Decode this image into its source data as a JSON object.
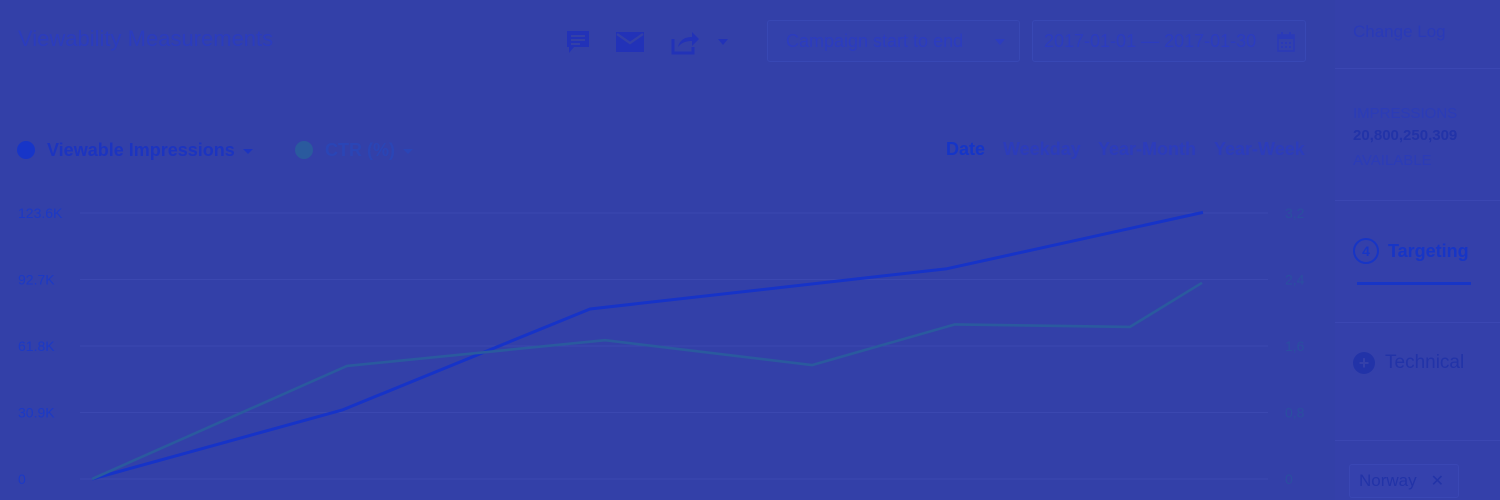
{
  "header": {
    "title": "Viewability Measurements",
    "icons": [
      "comment-icon",
      "mail-icon",
      "share-icon",
      "chevron-down-icon"
    ],
    "range_select": "Campaign start to end",
    "date_range": "2017-01-01 — 2017-01-30"
  },
  "legend": {
    "series1": "Viewable Impressions",
    "series2": "CTR (%)"
  },
  "granularity": {
    "options": [
      "Date",
      "Weekday",
      "Year-Month",
      "Year-Week"
    ],
    "active": "Date"
  },
  "colors": {
    "background": "#3340a8",
    "impressions": "#1633c8",
    "ctr": "#2a5a9e",
    "grid": "#3b48b0",
    "left_tick": "#1c39c6",
    "right_tick": "#2a4fa0"
  },
  "chart_data": {
    "type": "line",
    "x": [
      1,
      2,
      3,
      4,
      5,
      6,
      7,
      8
    ],
    "series": [
      {
        "name": "Viewable Impressions",
        "axis": "left",
        "values": [
          0,
          32000,
          79000,
          88500,
          97700,
          123900
        ]
      },
      {
        "name": "CTR (%)",
        "axis": "right",
        "values": [
          0,
          1.36,
          1.67,
          1.37,
          1.86,
          1.83,
          2.36
        ]
      }
    ],
    "left_ticks": [
      "0",
      "30.9K",
      "61.8K",
      "92.7K",
      "123.6K"
    ],
    "right_ticks": [
      "0",
      "0,8",
      "1,6",
      "2,4",
      "3,2"
    ],
    "ylim_left": [
      0,
      123600
    ],
    "ylim_right": [
      0,
      3.2
    ],
    "grid": true
  },
  "right_panel": {
    "change_log": "Change Log",
    "impressions_label": "IMPRESSIONS",
    "impressions_count": "20,800,250,309",
    "available_label": "AVAILABLE",
    "targeting_count": "4",
    "targeting_label": "Targeting",
    "technical_label": "Technical",
    "chip_label": "Norway"
  }
}
